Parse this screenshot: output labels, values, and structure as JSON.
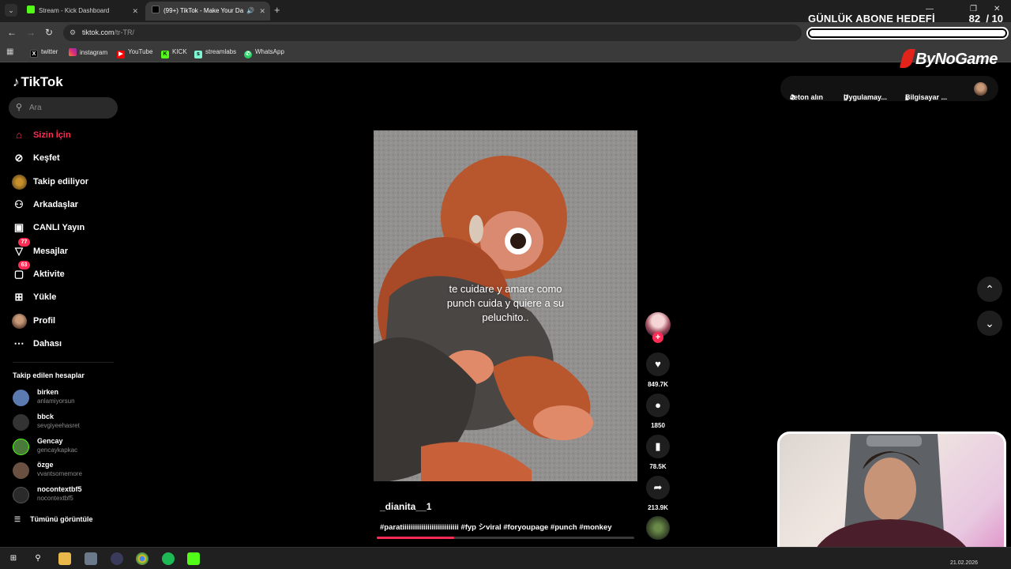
{
  "browser": {
    "tabs": [
      {
        "title": "Stream - Kick Dashboard",
        "icon": "kick-icon"
      },
      {
        "title": "(99+) TikTok - Make Your Da",
        "icon": "tiktok-icon"
      }
    ],
    "url_host": "tiktok.com",
    "url_path": "/tr-TR/",
    "bookmarks": [
      "twitter",
      "instagram",
      "YouTube",
      "KICK",
      "streamlabs",
      "WhatsApp"
    ]
  },
  "overlay": {
    "goal_label": "GÜNLÜK ABONE HEDEFİ",
    "goal_current": "82",
    "goal_total": "/ 10",
    "brand": "ByNoGame"
  },
  "tiktok": {
    "logo_text": "TikTok",
    "search_placeholder": "Ara",
    "nav": [
      {
        "label": "Sizin İçin",
        "icon": "home-icon",
        "active": true
      },
      {
        "label": "Keşfet",
        "icon": "compass-icon"
      },
      {
        "label": "Takip ediliyor",
        "icon": "following-avatar-icon"
      },
      {
        "label": "Arkadaşlar",
        "icon": "friends-icon"
      },
      {
        "label": "CANLI Yayın",
        "icon": "live-icon"
      },
      {
        "label": "Mesajlar",
        "icon": "messages-icon",
        "badge": "77"
      },
      {
        "label": "Aktivite",
        "icon": "activity-icon",
        "badge": "63"
      },
      {
        "label": "Yükle",
        "icon": "upload-icon"
      },
      {
        "label": "Profil",
        "icon": "profile-avatar-icon"
      },
      {
        "label": "Dahası",
        "icon": "more-icon"
      }
    ],
    "following_title": "Takip edilen hesaplar",
    "following": [
      {
        "name": "birken",
        "user": "anlamiyorsun",
        "color": "#5a7ab0"
      },
      {
        "name": "bbck",
        "user": "sevgiyeehasret",
        "color": "#333333"
      },
      {
        "name": "Gencay",
        "user": "gencaykapkac",
        "color": "#4a7a3a"
      },
      {
        "name": "özge",
        "user": "vvantsomemore",
        "color": "#6a5040"
      },
      {
        "name": "nocontextbf5",
        "user": "nocontextbf5",
        "color": "#2a2a2a"
      }
    ],
    "see_all": "Tümünü görüntüle",
    "top_actions": {
      "coins": "Jeton alın",
      "app": "Uygulamay...",
      "desktop": "Bilgisayar ..."
    }
  },
  "video": {
    "overlay_text": "te cuidare y amare como punch cuida y quiere a su peluchito..",
    "author": "_dianita__1",
    "tags": "#paratiiiiiiiiiiiiiiiiiiiiiiiiiii #fyp シviral #foryoupage #punch #monkey",
    "progress": 0.3,
    "likes": "849.7K",
    "comments": "1850",
    "saves": "78.5K",
    "shares": "213.9K"
  },
  "taskbar": {
    "date": "21.02.2026"
  },
  "colors": {
    "accent": "#fe2c55",
    "kick": "#53fc18"
  }
}
